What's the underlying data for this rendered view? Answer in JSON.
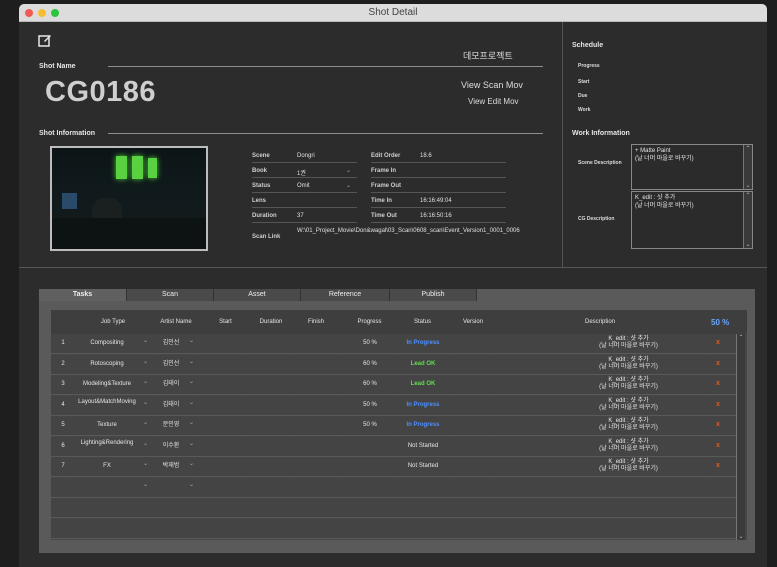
{
  "window": {
    "title": "Shot Detail"
  },
  "header": {
    "shot_name_label": "Shot Name",
    "shot_name": "CG0186",
    "project_name": "데모프로젝트",
    "view_scan_mov": "View Scan Mov",
    "view_edit_mov": "View Edit Mov"
  },
  "shot_info": {
    "label": "Shot Information",
    "left_fields": [
      {
        "label": "Scene",
        "value": "Dongri"
      },
      {
        "label": "Book",
        "value": "1권"
      },
      {
        "label": "Status",
        "value": "Omit"
      },
      {
        "label": "Lens",
        "value": ""
      },
      {
        "label": "Duration",
        "value": "37"
      },
      {
        "label": "Scan Link",
        "value": "W:\\01_Project_Movie\\Don&wagal\\03_Scan\\0608_scan\\Event_Version1_0001_0006"
      }
    ],
    "right_fields": [
      {
        "label": "Edit Order",
        "value": "18.6"
      },
      {
        "label": "Frame In",
        "value": ""
      },
      {
        "label": "Frame Out",
        "value": ""
      },
      {
        "label": "Time In",
        "value": "16:16:49:04"
      },
      {
        "label": "Time Out",
        "value": "16:16:50:16"
      }
    ]
  },
  "schedule": {
    "label": "Schedule",
    "items": [
      "Progress",
      "Start",
      "Due",
      "Work"
    ]
  },
  "work_info": {
    "label": "Work Information",
    "scene_description_label": "Scene Description",
    "scene_description_lines": [
      "+ Matte Paint",
      "(날 너머 마을로 바꾸기)"
    ],
    "cg_description_label": "CG Description",
    "cg_description_lines": [
      "K_edit : 샷 추가",
      "(날 너머 마을로 바꾸기)"
    ]
  },
  "tabs": [
    "Tasks",
    "Scan",
    "Asset",
    "Reference",
    "Publish"
  ],
  "tasks_table": {
    "headers": [
      "Job Type",
      "Artist Name",
      "Start",
      "Duration",
      "Finish",
      "Progress",
      "Status",
      "Version",
      "Description"
    ],
    "overall_progress": "50 %",
    "rows": [
      {
        "num": "1",
        "job_type": "Compositing",
        "artist": "김민선",
        "progress": "50 %",
        "status": "In Progress",
        "status_color": "#4d8fff",
        "desc1": "K_edit : 샷 추가",
        "desc2": "(날 너머 마을로 바꾸기)",
        "delete": "x"
      },
      {
        "num": "2",
        "job_type": "Rotoscoping",
        "artist": "김민선",
        "progress": "60 %",
        "status": "Lead OK",
        "status_color": "#5ee04a",
        "desc1": "K_edit : 샷 추가",
        "desc2": "(날 너머 마을로 바꾸기)",
        "delete": "x"
      },
      {
        "num": "3",
        "job_type": "Modeling&Texture",
        "artist": "김태이",
        "progress": "60 %",
        "status": "Lead OK",
        "status_color": "#5ee04a",
        "desc1": "K_edit : 샷 추가",
        "desc2": "(날 너머 마을로 바꾸기)",
        "delete": "x"
      },
      {
        "num": "4",
        "job_type": "Layout&MatchMoving",
        "artist": "김태이",
        "progress": "50 %",
        "status": "In Progress",
        "status_color": "#4d8fff",
        "desc1": "K_edit : 샷 추가",
        "desc2": "(날 너머 마을로 바꾸기)",
        "delete": "x"
      },
      {
        "num": "5",
        "job_type": "Texture",
        "artist": "문민영",
        "progress": "50 %",
        "status": "In Progress",
        "status_color": "#4d8fff",
        "desc1": "K_edit : 샷 추가",
        "desc2": "(날 너머 마을로 바꾸기)",
        "delete": "x"
      },
      {
        "num": "6",
        "job_type": "Lighting&Rendering",
        "artist": "이수환",
        "progress": "",
        "status": "Not Started",
        "status_color": "#e6e6e6",
        "desc1": "K_edit : 샷 추가",
        "desc2": "(날 너머 마을로 바꾸기)",
        "delete": "x"
      },
      {
        "num": "7",
        "job_type": "FX",
        "artist": "박재범",
        "progress": "",
        "status": "Not Started",
        "status_color": "#e6e6e6",
        "desc1": "K_edit : 샷 추가",
        "desc2": "(날 너머 마을로 바꾸기)",
        "delete": "x"
      }
    ]
  }
}
